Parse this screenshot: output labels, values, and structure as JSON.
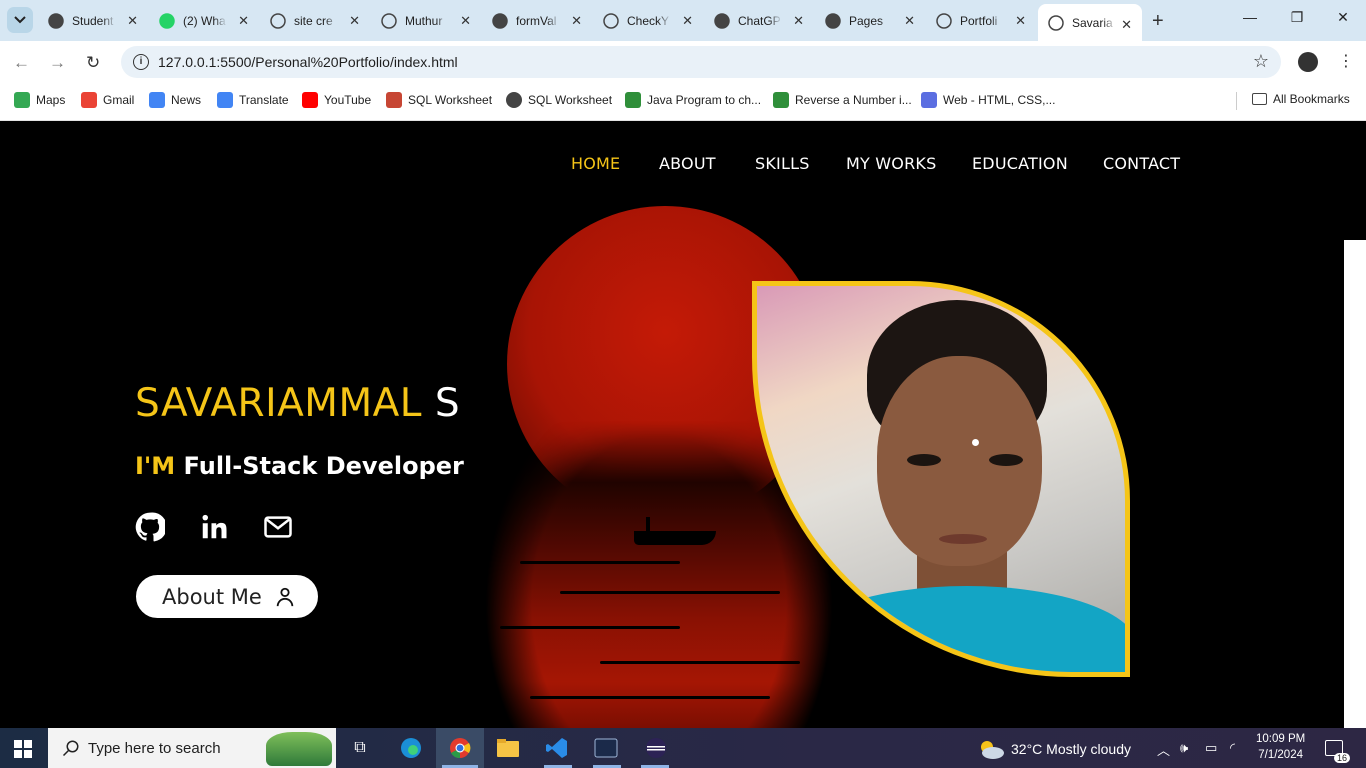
{
  "browser": {
    "tabs": [
      {
        "label": "Student",
        "icon": "github-icon"
      },
      {
        "label": "(2) Wha",
        "icon": "whatsapp-icon"
      },
      {
        "label": "site cre",
        "icon": "globe-icon"
      },
      {
        "label": "Muthur",
        "icon": "globe-icon"
      },
      {
        "label": "formVal",
        "icon": "github-icon"
      },
      {
        "label": "CheckY",
        "icon": "globe-icon"
      },
      {
        "label": "ChatGP",
        "icon": "openai-icon"
      },
      {
        "label": "Pages",
        "icon": "github-icon"
      },
      {
        "label": "Portfoli",
        "icon": "globe-icon"
      },
      {
        "label": "Savaria",
        "icon": "globe-icon",
        "active": true
      }
    ],
    "url": "127.0.0.1:5500/Personal%20Portfolio/index.html",
    "bookmarks": [
      {
        "label": "Maps",
        "icon": "maps-icon"
      },
      {
        "label": "Gmail",
        "icon": "gmail-icon"
      },
      {
        "label": "News",
        "icon": "news-icon"
      },
      {
        "label": "Translate",
        "icon": "translate-icon"
      },
      {
        "label": "YouTube",
        "icon": "youtube-icon"
      },
      {
        "label": "SQL Worksheet",
        "icon": "sql-icon"
      },
      {
        "label": "SQL Worksheet",
        "icon": "globe-icon"
      },
      {
        "label": "Java Program to ch...",
        "icon": "play-icon"
      },
      {
        "label": "Reverse a Number i...",
        "icon": "play-icon"
      },
      {
        "label": "Web - HTML, CSS,...",
        "icon": "code-icon"
      }
    ],
    "all_bookmarks": "All Bookmarks"
  },
  "site": {
    "nav": [
      {
        "label": "HOME",
        "active": true
      },
      {
        "label": "ABOUT"
      },
      {
        "label": "SKILLS"
      },
      {
        "label": "MY WORKS"
      },
      {
        "label": "EDUCATION"
      },
      {
        "label": "CONTACT"
      }
    ],
    "name_first": "SAVARIAMMAL",
    "name_last": "S",
    "role_prefix": "I'M",
    "role": "Full-Stack Developer",
    "social": [
      "github-icon",
      "linkedin-icon",
      "mail-icon"
    ],
    "about_button": "About Me",
    "accent_color": "#f5c518"
  },
  "taskbar": {
    "search_placeholder": "Type here to search",
    "weather": "32°C  Mostly cloudy",
    "time": "10:09 PM",
    "date": "7/1/2024",
    "notifications": "16"
  }
}
